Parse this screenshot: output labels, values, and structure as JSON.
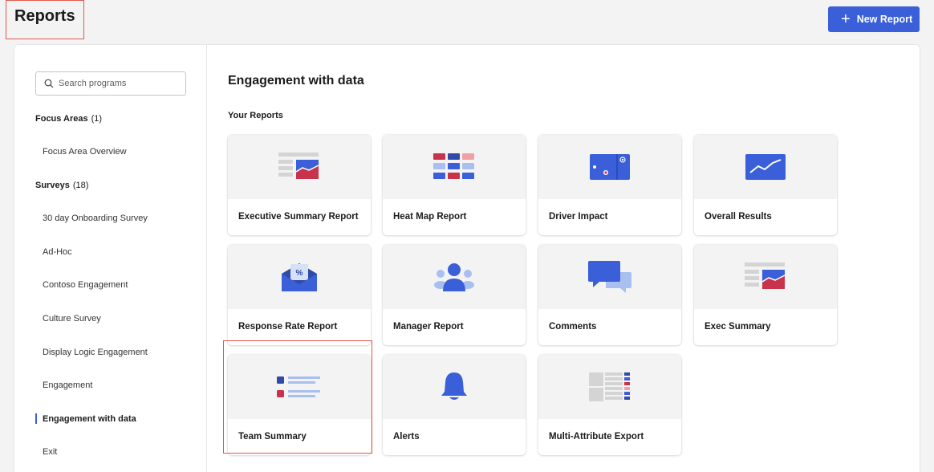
{
  "header": {
    "page_title": "Reports",
    "new_report_label": "New Report"
  },
  "sidebar": {
    "search_placeholder": "Search programs",
    "focus_areas": {
      "label": "Focus Areas",
      "count": "(1)"
    },
    "focus_items": [
      "Focus Area Overview"
    ],
    "surveys": {
      "label": "Surveys",
      "count": "(18)"
    },
    "survey_items": [
      "30 day Onboarding Survey",
      "Ad-Hoc",
      "Contoso Engagement",
      "Culture Survey",
      "Display Logic Engagement",
      "Engagement",
      "Engagement with data",
      "Exit"
    ],
    "active_item": "Engagement with data"
  },
  "main": {
    "title": "Engagement with data",
    "section_label": "Your Reports",
    "cards": [
      {
        "label": "Executive Summary Report",
        "icon": "executive-summary-icon"
      },
      {
        "label": "Heat Map Report",
        "icon": "heat-map-icon"
      },
      {
        "label": "Driver Impact",
        "icon": "driver-impact-icon"
      },
      {
        "label": "Overall Results",
        "icon": "overall-results-icon"
      },
      {
        "label": "Response Rate Report",
        "icon": "response-rate-icon"
      },
      {
        "label": "Manager Report",
        "icon": "manager-report-icon"
      },
      {
        "label": "Comments",
        "icon": "comments-icon"
      },
      {
        "label": "Exec Summary",
        "icon": "exec-summary-icon"
      },
      {
        "label": "Team Summary",
        "icon": "team-summary-icon"
      },
      {
        "label": "Alerts",
        "icon": "alerts-icon"
      },
      {
        "label": "Multi-Attribute Export",
        "icon": "multi-attribute-export-icon"
      }
    ]
  },
  "colors": {
    "accent": "#3a5fd9",
    "highlight": "#e0584e",
    "red": "#c8324a"
  }
}
